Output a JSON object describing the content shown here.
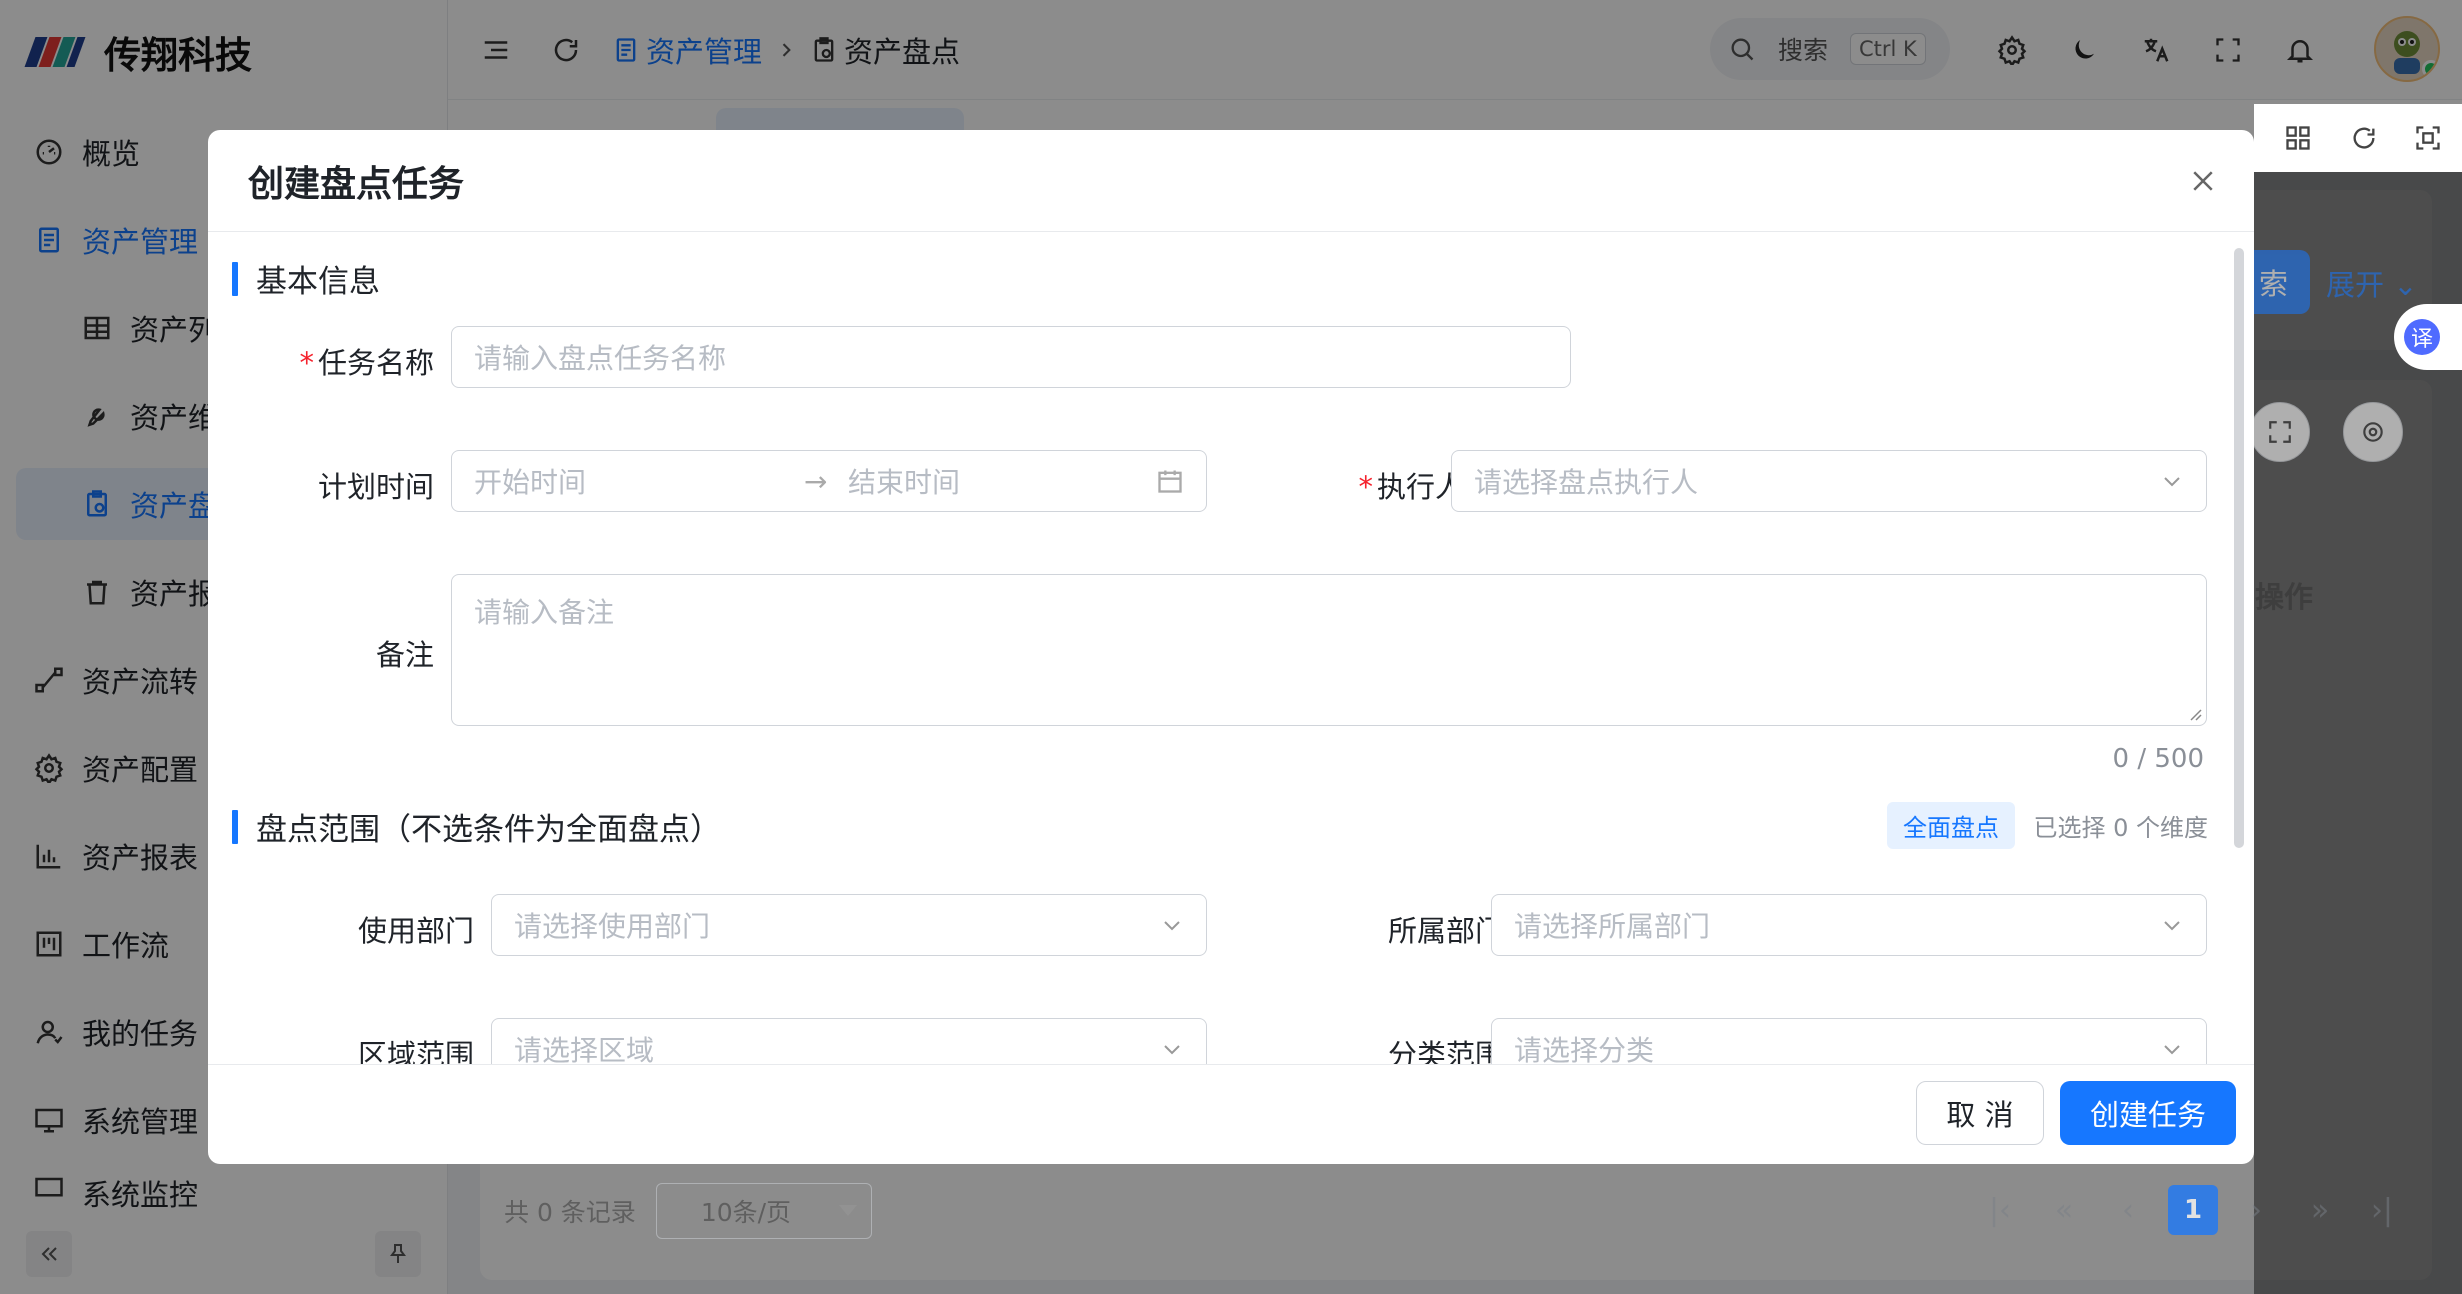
{
  "app": {
    "brand": "传翔科技"
  },
  "sidebar": {
    "items": [
      {
        "label": "概览",
        "icon": "dashboard-icon"
      },
      {
        "label": "资产管理",
        "icon": "document-icon"
      },
      {
        "label": "资产列",
        "icon": "table-icon"
      },
      {
        "label": "资产维",
        "icon": "wrench-icon"
      },
      {
        "label": "资产盘",
        "icon": "clipboard-icon"
      },
      {
        "label": "资产报",
        "icon": "trash-icon"
      },
      {
        "label": "资产流转",
        "icon": "flow-icon"
      },
      {
        "label": "资产配置",
        "icon": "gear-icon"
      },
      {
        "label": "资产报表",
        "icon": "bar-chart-icon"
      },
      {
        "label": "工作流",
        "icon": "kanban-icon"
      },
      {
        "label": "我的任务",
        "icon": "user-icon"
      },
      {
        "label": "系统管理",
        "icon": "monitor-icon"
      },
      {
        "label": "系统监控",
        "icon": "monitor-icon"
      }
    ]
  },
  "topbar": {
    "breadcrumb": [
      "资产管理",
      "资产盘点"
    ],
    "search_label": "搜索",
    "search_shortcut": "Ctrl K"
  },
  "background": {
    "search_btn": "索",
    "expand": "展开",
    "translate": "译",
    "col_action": "操作",
    "total": "共 0 条记录",
    "page_size": "10条/页",
    "current_page": "1"
  },
  "modal": {
    "title": "创建盘点任务",
    "section_basic": "基本信息",
    "task_name_label": "任务名称",
    "task_name_placeholder": "请输入盘点任务名称",
    "plan_time_label": "计划时间",
    "start_placeholder": "开始时间",
    "end_placeholder": "结束时间",
    "executor_label": "执行人",
    "executor_placeholder": "请选择盘点执行人",
    "remark_label": "备注",
    "remark_placeholder": "请输入备注",
    "remark_counter": "0 / 500",
    "section_scope": "盘点范围（不选条件为全面盘点）",
    "scope_tag": "全面盘点",
    "scope_selected": "已选择 0 个维度",
    "use_dept_label": "使用部门",
    "use_dept_placeholder": "请选择使用部门",
    "own_dept_label": "所属部门",
    "own_dept_placeholder": "请选择所属部门",
    "area_label": "区域范围",
    "area_placeholder": "请选择区域",
    "category_label": "分类范围",
    "category_placeholder": "请选择分类",
    "cancel": "取 消",
    "submit": "创建任务"
  }
}
